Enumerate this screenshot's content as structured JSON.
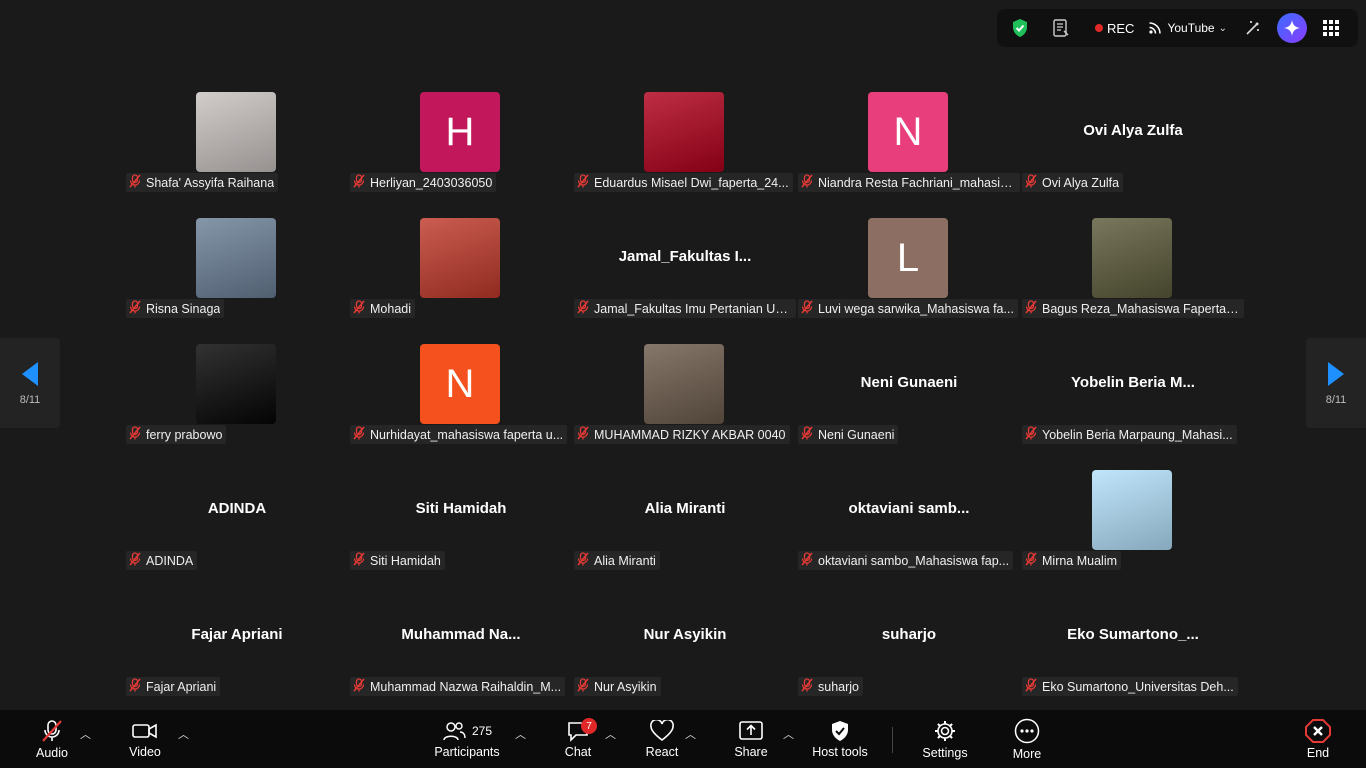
{
  "topbar": {
    "rec_label": "REC",
    "stream_label": "YouTube",
    "icons": [
      "shield-check-icon",
      "notes-icon",
      "broadcast-icon",
      "magic-wand-icon",
      "ai-companion-icon",
      "apps-grid-icon"
    ]
  },
  "pagination": {
    "left": "8/11",
    "right": "8/11"
  },
  "participants": [
    {
      "display": "Shafa' Assyifa Raihana",
      "avatar": "photo",
      "color": "#c8c2c0"
    },
    {
      "display": "Herliyan_2403036050",
      "avatar": "letter",
      "letter": "H",
      "color": "#c2185b"
    },
    {
      "display": "Eduardus Misael Dwi_faperta_24...",
      "avatar": "photo",
      "color": "#b0001b"
    },
    {
      "display": "Niandra Resta Fachriani_mahasis...",
      "avatar": "letter",
      "letter": "N",
      "color": "#e83e7c"
    },
    {
      "display": "Ovi Alya Zulfa",
      "avatar": "name",
      "big": "Ovi Alya Zulfa"
    },
    {
      "display": "Risna Sinaga",
      "avatar": "photo",
      "color": "#6a7f96"
    },
    {
      "display": "Mohadi",
      "avatar": "photo",
      "color": "#c0392b"
    },
    {
      "display": "Jamal_Fakultas Imu Pertanian Un...",
      "avatar": "name",
      "big": "Jamal_Fakultas  I..."
    },
    {
      "display": "Luvi wega sarwika_Mahasiswa fa...",
      "avatar": "letter",
      "letter": "L",
      "color": "#8d6e63"
    },
    {
      "display": "Bagus Reza_Mahasiswa Faperta ...",
      "avatar": "photo",
      "color": "#5b5a3a"
    },
    {
      "display": "ferry prabowo",
      "avatar": "photo",
      "color": "#050505"
    },
    {
      "display": "Nurhidayat_mahasiswa faperta u...",
      "avatar": "letter",
      "letter": "N",
      "color": "#f4511e"
    },
    {
      "display": "MUHAMMAD RIZKY AKBAR 0040",
      "avatar": "photo",
      "color": "#6b5a4a"
    },
    {
      "display": "Neni Gunaeni",
      "avatar": "name",
      "big": "Neni Gunaeni"
    },
    {
      "display": "Yobelin Beria Marpaung_Mahasi...",
      "avatar": "name",
      "big": "Yobelin  Beria  M..."
    },
    {
      "display": "ADINDA",
      "avatar": "name",
      "big": "ADINDA"
    },
    {
      "display": "Siti Hamidah",
      "avatar": "name",
      "big": "Siti Hamidah"
    },
    {
      "display": "Alia Miranti",
      "avatar": "name",
      "big": "Alia Miranti"
    },
    {
      "display": "oktaviani sambo_Mahasiswa fap...",
      "avatar": "name",
      "big": "oktaviani  samb..."
    },
    {
      "display": "Mirna Mualim",
      "avatar": "photo",
      "color": "#b3e0fb"
    },
    {
      "display": "Fajar Apriani",
      "avatar": "name",
      "big": "Fajar Apriani"
    },
    {
      "display": "Muhammad Nazwa Raihaldin_M...",
      "avatar": "name",
      "big": "Muhammad  Na..."
    },
    {
      "display": "Nur Asyikin",
      "avatar": "name",
      "big": "Nur Asyikin"
    },
    {
      "display": "suharjo",
      "avatar": "name",
      "big": "suharjo"
    },
    {
      "display": "Eko Sumartono_Universitas Deh...",
      "avatar": "name",
      "big": "Eko  Sumartono_..."
    }
  ],
  "bottombar": {
    "audio": "Audio",
    "video": "Video",
    "participants": "Participants",
    "participants_count": "275",
    "chat": "Chat",
    "chat_badge": "7",
    "react": "React",
    "share": "Share",
    "host_tools": "Host tools",
    "settings": "Settings",
    "more": "More",
    "end": "End"
  }
}
